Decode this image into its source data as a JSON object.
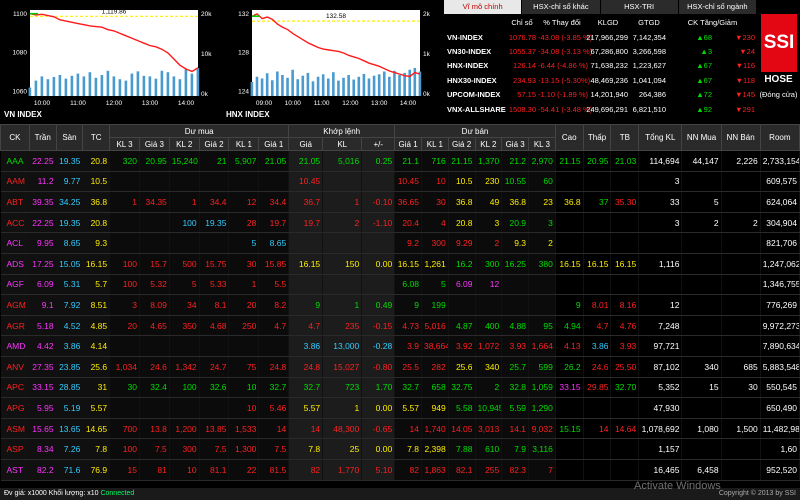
{
  "colors": {
    "down": "#ff2020",
    "up": "#00dd00",
    "ceiling": "#ff33ff",
    "floor": "#33ccff",
    "ref": "#ffee00",
    "chart_line": "#ff1a1a",
    "volume": "#4a9ad0",
    "ref_line": "#ffee00"
  },
  "vn_chart": {
    "title": "VN INDEX",
    "annotation": "1,119.86",
    "y_left_ticks": [
      "1100",
      "1080",
      "1060"
    ],
    "y_right_ticks": [
      "20k",
      "10k",
      "0k"
    ],
    "x_ticks": [
      "10:00",
      "11:00",
      "12:00",
      "13:00",
      "14:00"
    ],
    "ylim": [
      1055,
      1125
    ],
    "ref_value": 1119.86,
    "series": [
      1122,
      1121,
      1121.5,
      1120.5,
      1119.5,
      1117,
      1116,
      1115,
      1114,
      1113,
      1112,
      1111.5,
      1111,
      1109,
      1108,
      1106,
      1104,
      1102,
      1100,
      1098,
      1096,
      1095,
      1093,
      1090,
      1085,
      1080,
      1077,
      1075,
      1078
    ],
    "volume": [
      30,
      55,
      70,
      60,
      68,
      75,
      62,
      72,
      80,
      70,
      85,
      65,
      75,
      90,
      70,
      60,
      55,
      80,
      88,
      72,
      70,
      62,
      90,
      85,
      70,
      60,
      95,
      80,
      100
    ]
  },
  "hnx_chart": {
    "title": "HNX INDEX",
    "annotation": "132.58",
    "y_left_ticks": [
      "132",
      "128",
      "124"
    ],
    "y_right_ticks": [
      "2k",
      "1k",
      "0k"
    ],
    "x_ticks": [
      "09:00",
      "10:00",
      "11:00",
      "12:00",
      "13:00",
      "14:00"
    ],
    "ylim": [
      123,
      134
    ],
    "ref_value": 132.58,
    "series": [
      133.2,
      133.5,
      132.9,
      133.1,
      132.8,
      132.2,
      131.8,
      131.5,
      131,
      130.6,
      130.2,
      129.8,
      129.5,
      129.2,
      129,
      128.9,
      128.8,
      128.7,
      128.5,
      128.2,
      128,
      127.8,
      127.5,
      127.2,
      127,
      126.8,
      126.5,
      126.2,
      126,
      125.8,
      125.6,
      125.5,
      126,
      125.8
    ],
    "volume": [
      40,
      55,
      50,
      65,
      45,
      70,
      60,
      52,
      75,
      48,
      58,
      66,
      42,
      55,
      62,
      50,
      68,
      44,
      52,
      60,
      47,
      55,
      63,
      50,
      58,
      62,
      70,
      55,
      72,
      60,
      66,
      75,
      80,
      70
    ]
  },
  "index_panel": {
    "tabs": [
      "Vĩ mô chính",
      "HSX-chỉ số khác",
      "HSX-TRI",
      "HSX-chỉ số ngành"
    ],
    "headers": [
      "",
      "Chỉ số",
      "% Thay đổi",
      "KLGD",
      "GTGD",
      "CK Tăng/Giảm",
      ""
    ],
    "rows": [
      {
        "name": "VN-INDEX",
        "value": "1076.78",
        "change": "-43.08 (-3.85 %)",
        "vol": "217,966,299",
        "val": "7,142,354",
        "up": "68",
        "down": "230"
      },
      {
        "name": "VN30-INDEX",
        "value": "1055.37",
        "change": "-34.08 (-3.13 %)",
        "vol": "67,286,800",
        "val": "3,266,598",
        "up": "3",
        "down": "24"
      },
      {
        "name": "HNX-INDEX",
        "value": "126.14",
        "change": "-6.44 (-4.86 %)",
        "vol": "71,638,232",
        "val": "1,223,627",
        "up": "67",
        "down": "116"
      },
      {
        "name": "HNX30-INDEX",
        "value": "234.93",
        "change": "-13.15 (-5.30%)",
        "vol": "48,469,236",
        "val": "1,041,094",
        "up": "67",
        "down": "118"
      },
      {
        "name": "UPCOM-INDEX",
        "value": "57.15",
        "change": "-1.10 (-1.89 %)",
        "vol": "14,201,940",
        "val": "264,386",
        "up": "72",
        "down": "145"
      },
      {
        "name": "VNX-ALLSHARE",
        "value": "1508.30",
        "change": "-54.41 (-3.48 %)",
        "vol": "249,696,291",
        "val": "6,821,510",
        "up": "92",
        "down": "291"
      }
    ]
  },
  "logo": {
    "brand": "SSI",
    "exchange": "HOSE",
    "status": "(Đóng cửa)"
  },
  "board": {
    "group_headers": {
      "buy": "Dư mua",
      "match": "Khớp lệnh",
      "sell": "Dư bán"
    },
    "headers": [
      "CK",
      "Trần",
      "Sàn",
      "TC",
      "KL 3",
      "Giá 3",
      "KL 2",
      "Giá 2",
      "KL 1",
      "Giá 1",
      "Giá",
      "KL",
      "+/-",
      "Giá 1",
      "KL 1",
      "Giá 2",
      "KL 2",
      "Giá 3",
      "KL 3",
      "Cao",
      "Thấp",
      "TB",
      "Tổng KL",
      "NN Mua",
      "NN Bán",
      "Room"
    ],
    "rows": [
      {
        "c": [
          "AAA",
          "22.25",
          "19.35",
          "20.8",
          "320",
          "20.95",
          "15,240",
          "21",
          "5,907",
          "21.05",
          "21.05",
          "5,016",
          "0.25",
          "21.1",
          "716",
          "21.15",
          "1,370",
          "21.2",
          "2,970",
          "21.15",
          "20.95",
          "21.03",
          "114,694",
          "44,147",
          "2,226",
          "2,733,154"
        ],
        "k": [
          "up",
          "ce",
          "fl",
          "rf",
          "up",
          "up",
          "up",
          "up",
          "up",
          "up",
          "up",
          "up",
          "up",
          "up",
          "up",
          "up",
          "up",
          "up",
          "up",
          "up",
          "up",
          "up",
          "wh",
          "wh",
          "wh",
          "wh"
        ]
      },
      {
        "c": [
          "AAM",
          "11.2",
          "9.77",
          "10.5",
          "",
          "",
          "",
          "",
          "",
          "",
          "10.45",
          "",
          "",
          "10.45",
          "10",
          "10.5",
          "230",
          "10.55",
          "60",
          "",
          "",
          "",
          "3",
          "",
          "",
          "609,575"
        ],
        "k": [
          "dn",
          "ce",
          "fl",
          "rf",
          "wh",
          "wh",
          "wh",
          "wh",
          "wh",
          "wh",
          "dn",
          "wh",
          "wh",
          "dn",
          "dn",
          "rf",
          "rf",
          "up",
          "up",
          "wh",
          "wh",
          "wh",
          "wh",
          "wh",
          "wh",
          "wh"
        ]
      },
      {
        "c": [
          "ABT",
          "39.35",
          "34.25",
          "36.8",
          "1",
          "34.35",
          "1",
          "34.4",
          "12",
          "34.4",
          "36.7",
          "1",
          "-0.10",
          "36.65",
          "30",
          "36.8",
          "49",
          "36.8",
          "23",
          "36.8",
          "37",
          "35.30",
          "33",
          "5",
          "",
          "624,064"
        ],
        "k": [
          "dn",
          "ce",
          "fl",
          "rf",
          "dn",
          "dn",
          "dn",
          "dn",
          "dn",
          "dn",
          "dn",
          "dn",
          "dn",
          "dn",
          "dn",
          "rf",
          "rf",
          "rf",
          "rf",
          "rf",
          "up",
          "dn",
          "wh",
          "wh",
          "wh",
          "wh"
        ]
      },
      {
        "c": [
          "ACC",
          "22.25",
          "19.35",
          "20.8",
          "",
          "",
          "100",
          "19.35",
          "28",
          "19.7",
          "19.7",
          "2",
          "-1.10",
          "20.4",
          "4",
          "20.8",
          "3",
          "20.9",
          "3",
          "",
          "",
          "",
          "3",
          "2",
          "2",
          "304,904"
        ],
        "k": [
          "dn",
          "ce",
          "fl",
          "rf",
          "wh",
          "wh",
          "fl",
          "fl",
          "dn",
          "dn",
          "dn",
          "dn",
          "dn",
          "dn",
          "dn",
          "rf",
          "rf",
          "up",
          "up",
          "wh",
          "wh",
          "wh",
          "wh",
          "wh",
          "wh",
          "wh"
        ]
      },
      {
        "c": [
          "ACL",
          "9.95",
          "8.65",
          "9.3",
          "",
          "",
          "",
          "",
          "5",
          "8.65",
          "",
          "",
          "",
          "9.2",
          "300",
          "9.29",
          "2",
          "9.3",
          "2",
          "",
          "",
          "",
          "",
          "",
          "",
          "821,706"
        ],
        "k": [
          "ce",
          "ce",
          "fl",
          "rf",
          "wh",
          "wh",
          "wh",
          "wh",
          "fl",
          "fl",
          "wh",
          "wh",
          "wh",
          "dn",
          "dn",
          "dn",
          "dn",
          "rf",
          "rf",
          "wh",
          "wh",
          "wh",
          "wh",
          "wh",
          "wh",
          "wh"
        ]
      },
      {
        "c": [
          "ADS",
          "17.25",
          "15.05",
          "16.15",
          "100",
          "15.7",
          "500",
          "15.75",
          "30",
          "15.85",
          "16.15",
          "150",
          "0.00",
          "16.15",
          "1,261",
          "16.2",
          "300",
          "16.25",
          "380",
          "16.15",
          "16.15",
          "16.15",
          "1,116",
          "",
          "",
          "1,247,062"
        ],
        "k": [
          "ce",
          "ce",
          "fl",
          "rf",
          "dn",
          "dn",
          "dn",
          "dn",
          "dn",
          "dn",
          "rf",
          "rf",
          "rf",
          "rf",
          "rf",
          "up",
          "up",
          "up",
          "up",
          "rf",
          "rf",
          "rf",
          "wh",
          "wh",
          "wh",
          "wh"
        ]
      },
      {
        "c": [
          "AGF",
          "6.09",
          "5.31",
          "5.7",
          "100",
          "5.32",
          "5",
          "5.33",
          "1",
          "5.5",
          "",
          "",
          "",
          "6.08",
          "5",
          "6.09",
          "12",
          "",
          "",
          "",
          "",
          "",
          "",
          "",
          "",
          "1,346,755"
        ],
        "k": [
          "ce",
          "ce",
          "fl",
          "rf",
          "dn",
          "dn",
          "dn",
          "dn",
          "dn",
          "dn",
          "wh",
          "wh",
          "wh",
          "up",
          "up",
          "ce",
          "ce",
          "wh",
          "wh",
          "wh",
          "wh",
          "wh",
          "wh",
          "wh",
          "wh",
          "wh"
        ]
      },
      {
        "c": [
          "AGM",
          "9.1",
          "7.92",
          "8.51",
          "3",
          "8.09",
          "34",
          "8.1",
          "20",
          "8.2",
          "9",
          "1",
          "0.49",
          "9",
          "199",
          "",
          "",
          "",
          "",
          "9",
          "8.01",
          "8.16",
          "12",
          "",
          "",
          "776,269"
        ],
        "k": [
          "dn",
          "ce",
          "fl",
          "rf",
          "dn",
          "dn",
          "dn",
          "dn",
          "dn",
          "dn",
          "up",
          "up",
          "up",
          "up",
          "up",
          "wh",
          "wh",
          "wh",
          "wh",
          "up",
          "dn",
          "dn",
          "wh",
          "wh",
          "wh",
          "wh"
        ]
      },
      {
        "c": [
          "AGR",
          "5.18",
          "4.52",
          "4.85",
          "20",
          "4.65",
          "350",
          "4.68",
          "250",
          "4.7",
          "4.7",
          "235",
          "-0.15",
          "4.73",
          "5,016",
          "4.87",
          "400",
          "4.88",
          "95",
          "4.94",
          "4.7",
          "4.76",
          "7,248",
          "",
          "",
          "9,972,273"
        ],
        "k": [
          "dn",
          "ce",
          "fl",
          "rf",
          "dn",
          "dn",
          "dn",
          "dn",
          "dn",
          "dn",
          "dn",
          "dn",
          "dn",
          "dn",
          "dn",
          "up",
          "up",
          "up",
          "up",
          "up",
          "dn",
          "dn",
          "wh",
          "wh",
          "wh",
          "wh"
        ]
      },
      {
        "c": [
          "AMD",
          "4.42",
          "3.86",
          "4.14",
          "",
          "",
          "",
          "",
          "",
          "",
          "3.86",
          "13,000",
          "-0.28",
          "3.9",
          "38,664",
          "3.92",
          "1,072",
          "3.93",
          "1,664",
          "4.13",
          "3.86",
          "3.93",
          "97,721",
          "",
          "",
          "7,890,634"
        ],
        "k": [
          "ce",
          "ce",
          "fl",
          "rf",
          "wh",
          "wh",
          "wh",
          "wh",
          "wh",
          "wh",
          "fl",
          "fl",
          "fl",
          "dn",
          "dn",
          "dn",
          "dn",
          "dn",
          "dn",
          "dn",
          "fl",
          "dn",
          "wh",
          "wh",
          "wh",
          "wh"
        ]
      },
      {
        "c": [
          "ANV",
          "27.35",
          "23.85",
          "25.6",
          "1,034",
          "24.6",
          "1,342",
          "24.7",
          "75",
          "24.8",
          "24.8",
          "15,027",
          "-0.80",
          "25.5",
          "282",
          "25.6",
          "340",
          "25.7",
          "599",
          "26.2",
          "24.6",
          "25.50",
          "87,102",
          "340",
          "685",
          "5,883,548"
        ],
        "k": [
          "dn",
          "ce",
          "fl",
          "rf",
          "dn",
          "dn",
          "dn",
          "dn",
          "dn",
          "dn",
          "dn",
          "dn",
          "dn",
          "dn",
          "dn",
          "rf",
          "rf",
          "up",
          "up",
          "up",
          "dn",
          "dn",
          "wh",
          "wh",
          "wh",
          "wh"
        ]
      },
      {
        "c": [
          "APC",
          "33.15",
          "28.85",
          "31",
          "30",
          "32.4",
          "100",
          "32.6",
          "10",
          "32.7",
          "32.7",
          "723",
          "1.70",
          "32.7",
          "658",
          "32.75",
          "2",
          "32.8",
          "1,059",
          "33.15",
          "29.85",
          "32.70",
          "5,352",
          "15",
          "30",
          "550,545"
        ],
        "k": [
          "dn",
          "ce",
          "fl",
          "rf",
          "up",
          "up",
          "up",
          "up",
          "up",
          "up",
          "up",
          "up",
          "up",
          "up",
          "up",
          "up",
          "up",
          "up",
          "up",
          "ce",
          "dn",
          "up",
          "wh",
          "wh",
          "wh",
          "wh"
        ]
      },
      {
        "c": [
          "APG",
          "5.95",
          "5.19",
          "5.57",
          "",
          "",
          "",
          "",
          "10",
          "5.46",
          "5.57",
          "1",
          "0.00",
          "5.57",
          "949",
          "5.58",
          "10,945",
          "5.59",
          "1,290",
          "",
          "",
          "",
          "47,930",
          "",
          "",
          "650,490"
        ],
        "k": [
          "dn",
          "ce",
          "fl",
          "rf",
          "wh",
          "wh",
          "wh",
          "wh",
          "dn",
          "dn",
          "rf",
          "rf",
          "rf",
          "rf",
          "rf",
          "up",
          "up",
          "up",
          "up",
          "wh",
          "wh",
          "wh",
          "wh",
          "wh",
          "wh",
          "wh"
        ]
      },
      {
        "c": [
          "ASM",
          "15.65",
          "13.65",
          "14.65",
          "700",
          "13.8",
          "1,200",
          "13.85",
          "1,533",
          "14",
          "14",
          "48,300",
          "-0.65",
          "14",
          "1,740",
          "14.05",
          "3,013",
          "14.1",
          "9,032",
          "15.15",
          "14",
          "14.64",
          "1,078,692",
          "1,080",
          "1,500",
          "11,482,981"
        ],
        "k": [
          "dn",
          "ce",
          "fl",
          "rf",
          "dn",
          "dn",
          "dn",
          "dn",
          "dn",
          "dn",
          "dn",
          "dn",
          "dn",
          "dn",
          "dn",
          "dn",
          "dn",
          "dn",
          "dn",
          "up",
          "dn",
          "dn",
          "wh",
          "wh",
          "wh",
          "wh"
        ]
      },
      {
        "c": [
          "ASP",
          "8.34",
          "7.26",
          "7.8",
          "100",
          "7.5",
          "300",
          "7.5",
          "1,300",
          "7.5",
          "7.8",
          "25",
          "0.00",
          "7.8",
          "2,398",
          "7.88",
          "610",
          "7.9",
          "3,116",
          "",
          "",
          "",
          "1,157",
          "",
          "",
          "1,60"
        ],
        "k": [
          "dn",
          "ce",
          "fl",
          "rf",
          "dn",
          "dn",
          "dn",
          "dn",
          "dn",
          "dn",
          "rf",
          "rf",
          "rf",
          "rf",
          "rf",
          "up",
          "up",
          "up",
          "up",
          "wh",
          "wh",
          "wh",
          "wh",
          "wh",
          "wh",
          "wh"
        ]
      },
      {
        "c": [
          "AST",
          "82.2",
          "71.6",
          "76.9",
          "15",
          "81",
          "10",
          "81.1",
          "22",
          "81.5",
          "82",
          "1,770",
          "5.10",
          "82",
          "1,863",
          "82.1",
          "255",
          "82.3",
          "7",
          "",
          "",
          "",
          "16,465",
          "6,458",
          "",
          "952,520"
        ],
        "k": [
          "ce",
          "ce",
          "fl",
          "rf",
          "dn",
          "dn",
          "dn",
          "dn",
          "dn",
          "dn",
          "dn",
          "dn",
          "dn",
          "dn",
          "dn",
          "dn",
          "dn",
          "dn",
          "dn",
          "wh",
          "wh",
          "wh",
          "wh",
          "wh",
          "wh",
          "wh"
        ]
      }
    ]
  },
  "footer": {
    "note": "Đv giá: x1000 Khối lượng: x10",
    "status": "Connected",
    "copyright": "Copyright © 2013 by SSI",
    "watermark": "Activate Windows"
  }
}
